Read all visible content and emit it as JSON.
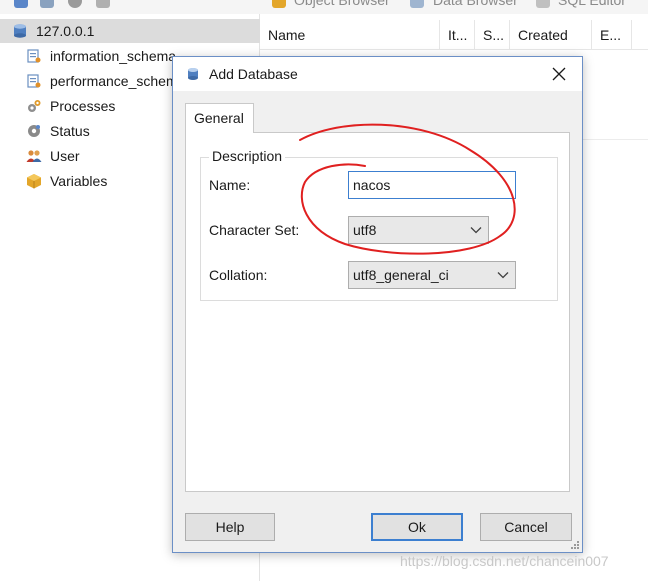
{
  "toolbar": {
    "object_browser": "Object Browser",
    "data_browser": "Data Browser",
    "sql_editor": "SQL Editor"
  },
  "tree": {
    "items": [
      {
        "label": "127.0.0.1",
        "icon": "server-icon",
        "selected": true
      },
      {
        "label": "information_schema",
        "icon": "database-icon"
      },
      {
        "label": "performance_schema",
        "icon": "database-icon"
      },
      {
        "label": "Processes",
        "icon": "gears-icon"
      },
      {
        "label": "Status",
        "icon": "status-gear-icon"
      },
      {
        "label": "User",
        "icon": "users-icon"
      },
      {
        "label": "Variables",
        "icon": "box-icon"
      }
    ]
  },
  "grid": {
    "columns": [
      "Name",
      "It...",
      "S...",
      "Created",
      "E..."
    ]
  },
  "dialog": {
    "title": "Add Database",
    "tab": "General",
    "group_title": "Description",
    "name_label": "Name:",
    "name_value": "nacos",
    "charset_label": "Character Set:",
    "charset_value": "utf8",
    "collation_label": "Collation:",
    "collation_value": "utf8_general_ci",
    "help_button": "Help",
    "ok_button": "Ok",
    "cancel_button": "Cancel"
  },
  "watermark": "https://blog.csdn.net/chancein007",
  "colors": {
    "accent": "#3c7fd0",
    "annotation": "#e02020",
    "selection": "#dcdcdc"
  }
}
